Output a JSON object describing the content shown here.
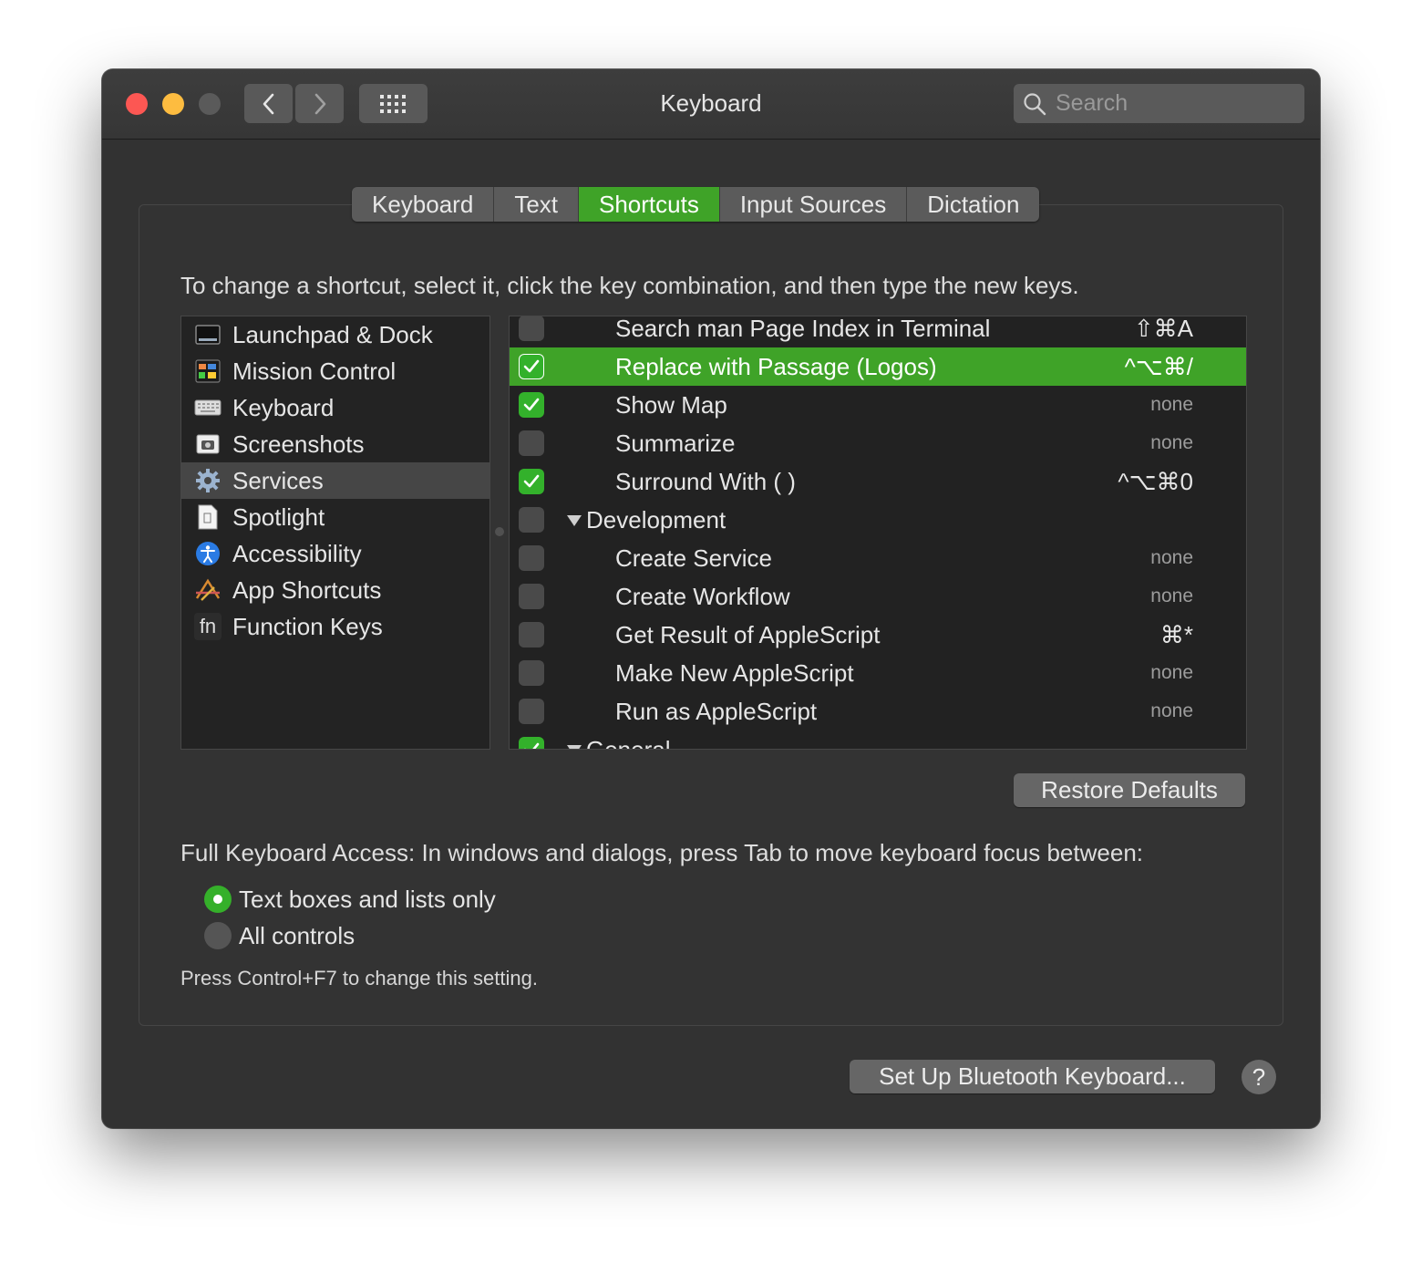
{
  "window": {
    "title": "Keyboard"
  },
  "toolbar": {
    "back_icon": "chevron-left-icon",
    "forward_icon": "chevron-right-icon",
    "show_all_icon": "grid-icon",
    "search_placeholder": "Search",
    "search_icon": "magnifier-icon"
  },
  "tabs": [
    {
      "label": "Keyboard"
    },
    {
      "label": "Text"
    },
    {
      "label": "Shortcuts",
      "active": true
    },
    {
      "label": "Input Sources"
    },
    {
      "label": "Dictation"
    }
  ],
  "instructions": "To change a shortcut, select it, click the key combination, and then type the new keys.",
  "categories": [
    {
      "label": "Launchpad & Dock",
      "icon": "launchpad-dock-icon"
    },
    {
      "label": "Mission Control",
      "icon": "mission-control-icon"
    },
    {
      "label": "Keyboard",
      "icon": "keyboard-icon"
    },
    {
      "label": "Screenshots",
      "icon": "screenshot-icon"
    },
    {
      "label": "Services",
      "icon": "gear-icon",
      "selected": true
    },
    {
      "label": "Spotlight",
      "icon": "spotlight-document-icon"
    },
    {
      "label": "Accessibility",
      "icon": "accessibility-icon"
    },
    {
      "label": "App Shortcuts",
      "icon": "app-shortcuts-icon"
    },
    {
      "label": "Function Keys",
      "icon": "fn-key-icon",
      "glyph": "fn"
    }
  ],
  "shortcuts": [
    {
      "label": "Search man Page Index in Terminal",
      "key": "⇧⌘A",
      "checked": false
    },
    {
      "label": "Replace with Passage (Logos)",
      "key": "^⌥⌘/",
      "checked": true,
      "selected": true
    },
    {
      "label": "Show Map",
      "key": "none",
      "checked": true
    },
    {
      "label": "Summarize",
      "key": "none",
      "checked": false
    },
    {
      "label": "Surround With ( )",
      "key": "^⌥⌘0",
      "checked": true
    },
    {
      "label": "Development",
      "group": true,
      "checked": false
    },
    {
      "label": "Create Service",
      "key": "none",
      "checked": false
    },
    {
      "label": "Create Workflow",
      "key": "none",
      "checked": false
    },
    {
      "label": "Get Result of AppleScript",
      "key": "⌘*",
      "checked": false
    },
    {
      "label": "Make New AppleScript",
      "key": "none",
      "checked": false
    },
    {
      "label": "Run as AppleScript",
      "key": "none",
      "checked": false
    },
    {
      "label": "General",
      "group": true,
      "checked": true
    }
  ],
  "restore_defaults": "Restore Defaults",
  "full_keyboard_access": {
    "label": "Full Keyboard Access: In windows and dialogs, press Tab to move keyboard focus between:",
    "options": [
      {
        "label": "Text boxes and lists only",
        "selected": true
      },
      {
        "label": "All controls",
        "selected": false
      }
    ],
    "hint": "Press Control+F7 to change this setting."
  },
  "bluetooth_button": "Set Up Bluetooth Keyboard...",
  "help_button": "?",
  "colors": {
    "accent": "#3fa328",
    "window_bg": "#323232",
    "list_bg": "#222222",
    "close": "#fc5753",
    "minimize": "#fdbc40"
  }
}
